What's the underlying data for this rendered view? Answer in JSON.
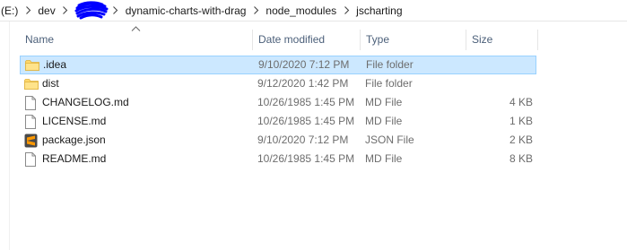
{
  "breadcrumb": {
    "drive": "(E:)",
    "dev": "dev",
    "project": "dynamic-charts-with-drag",
    "node_modules": "node_modules",
    "current": "jscharting"
  },
  "columns": {
    "name": "Name",
    "date_modified": "Date modified",
    "type": "Type",
    "size": "Size"
  },
  "files": [
    {
      "name": ".idea",
      "date": "9/10/2020 7:12 PM",
      "type": "File folder",
      "size": "",
      "icon": "folder-icon",
      "selected": true
    },
    {
      "name": "dist",
      "date": "9/12/2020 1:42 PM",
      "type": "File folder",
      "size": "",
      "icon": "folder-icon",
      "selected": false
    },
    {
      "name": "CHANGELOG.md",
      "date": "10/26/1985 1:45 PM",
      "type": "MD File",
      "size": "4 KB",
      "icon": "document-icon",
      "selected": false
    },
    {
      "name": "LICENSE.md",
      "date": "10/26/1985 1:45 PM",
      "type": "MD File",
      "size": "1 KB",
      "icon": "document-icon",
      "selected": false
    },
    {
      "name": "package.json",
      "date": "9/10/2020 7:12 PM",
      "type": "JSON File",
      "size": "2 KB",
      "icon": "sublime-text-icon",
      "selected": false
    },
    {
      "name": "README.md",
      "date": "10/26/1985 1:45 PM",
      "type": "MD File",
      "size": "8 KB",
      "icon": "document-icon",
      "selected": false
    }
  ],
  "colors": {
    "selection_bg": "#cce8ff",
    "selection_border": "#99d1ff",
    "header_text": "#4c607a",
    "redaction": "#0000ff"
  }
}
